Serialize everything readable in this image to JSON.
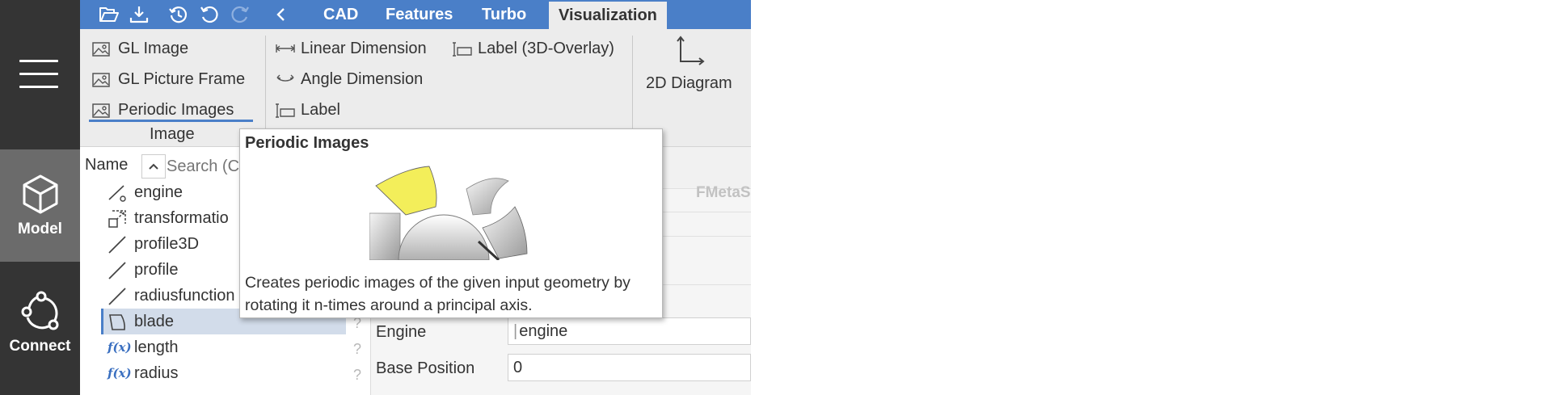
{
  "sidebar": {
    "items": [
      {
        "label": "Model",
        "icon": "cube-icon",
        "active": true
      },
      {
        "label": "Connect",
        "icon": "connect-icon",
        "active": false
      }
    ]
  },
  "toolbar": {
    "icons": [
      "folder-open-icon",
      "download-icon",
      "history-icon",
      "undo-icon",
      "redo-icon",
      "back-chevron-icon"
    ],
    "tabs": [
      {
        "label": "CAD"
      },
      {
        "label": "Features"
      },
      {
        "label": "Turbo"
      },
      {
        "label": "Visualization",
        "active": true
      }
    ]
  },
  "ribbon": {
    "image_group": {
      "items": [
        "GL Image",
        "GL Picture Frame",
        "Periodic Images"
      ],
      "label": "Image"
    },
    "annotation_group": {
      "items": [
        "Linear Dimension",
        "Angle Dimension",
        "Label",
        "Label (3D-Overlay)"
      ]
    },
    "diagram": {
      "label": "2D Diagram"
    }
  },
  "tree": {
    "column_header": "Name",
    "search_placeholder": "Search (C",
    "items": [
      {
        "label": "engine",
        "icon": "curve-icon"
      },
      {
        "label": "transformatio",
        "icon": "transform-icon"
      },
      {
        "label": "profile3D",
        "icon": "line-icon"
      },
      {
        "label": "profile",
        "icon": "line-icon"
      },
      {
        "label": "radiusfunction",
        "icon": "line-icon"
      },
      {
        "label": "blade",
        "icon": "surface-icon",
        "selected": true
      },
      {
        "label": "length",
        "icon": "function-icon"
      },
      {
        "label": "radius",
        "icon": "function-icon"
      }
    ],
    "help_mark": "?"
  },
  "properties": {
    "faded_header": "FMetaS",
    "fields": [
      {
        "label": "Engine",
        "value": "engine"
      },
      {
        "label": "Base Position",
        "value": "0"
      }
    ]
  },
  "tooltip": {
    "title": "Periodic Images",
    "description": "Creates periodic images of the given input geometry by rotating it n-times around a principal axis."
  },
  "colors": {
    "accent": "#4a7fc8",
    "sidebar": "#343434",
    "sidebar_active": "#6b6b6b",
    "ribbon": "#ececec"
  }
}
